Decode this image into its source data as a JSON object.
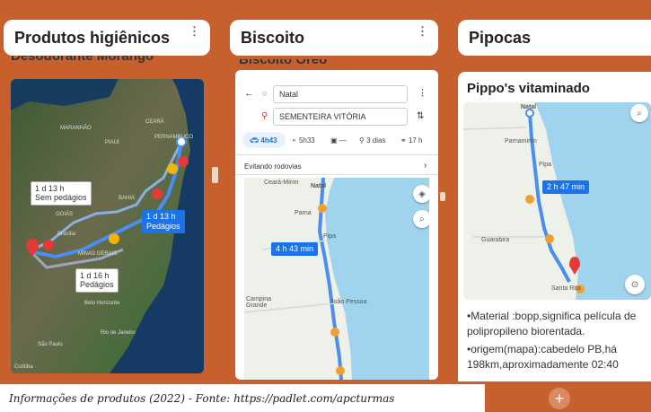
{
  "columns": [
    {
      "title": "Produtos higiênicos",
      "menu": "⋮",
      "cut_title": "Desodorante Morango",
      "map_labels": {
        "chip1": "1 d 13 h",
        "chip1b": "Sem pedágios",
        "chip2": "1 d 13 h",
        "chip2b": "Pedágios",
        "chip3": "1 d 16 h",
        "chip3b": "Pedágios",
        "cities": [
          "MARANHÃO",
          "CEARÁ",
          "PIAUÍ",
          "PERNAMBUCO",
          "BAHIA",
          "GOIÁS",
          "MINAS GERAIS",
          "Brasília",
          "Belo Horizonte",
          "São Paulo",
          "Rio de Janeiro",
          "Curitiba"
        ]
      }
    },
    {
      "title": "Biscoito",
      "menu": "⋮",
      "cut_title": "Biscoito Oreo",
      "origin": "Natal",
      "destination": "SEMENTEIRA VITÓRIA",
      "modes": [
        "4h43",
        "5h33",
        "—",
        "3 dias",
        "17 h"
      ],
      "avoid": "Evitando rodovias",
      "route_time": "4 h 43 min",
      "map_cities": [
        "Ceará-Mirim",
        "Natal",
        "Parna",
        "Pipa",
        "João Pessoa",
        "Campina Grande"
      ]
    },
    {
      "title": "Pipocas",
      "card_title": "Pippo's vitaminado",
      "route_time": "2 h 47 min",
      "map_cities": [
        "Natal",
        "Parnamirim",
        "Pipa",
        "Guarabira",
        "Santa Rita"
      ],
      "description": [
        "•Material :bopp,significa película de polipropileno biorentada.",
        "•origem(mapa):cabedelo PB,há 198km,aproximadamente 02:40"
      ]
    }
  ],
  "caption": "Informações de produtos (2022) - Fonte: https://padlet.com/apcturmas",
  "add_button": "+",
  "colors": {
    "background": "#c8602e",
    "route": "#4a8ef0",
    "accent": "#1a73e8"
  }
}
